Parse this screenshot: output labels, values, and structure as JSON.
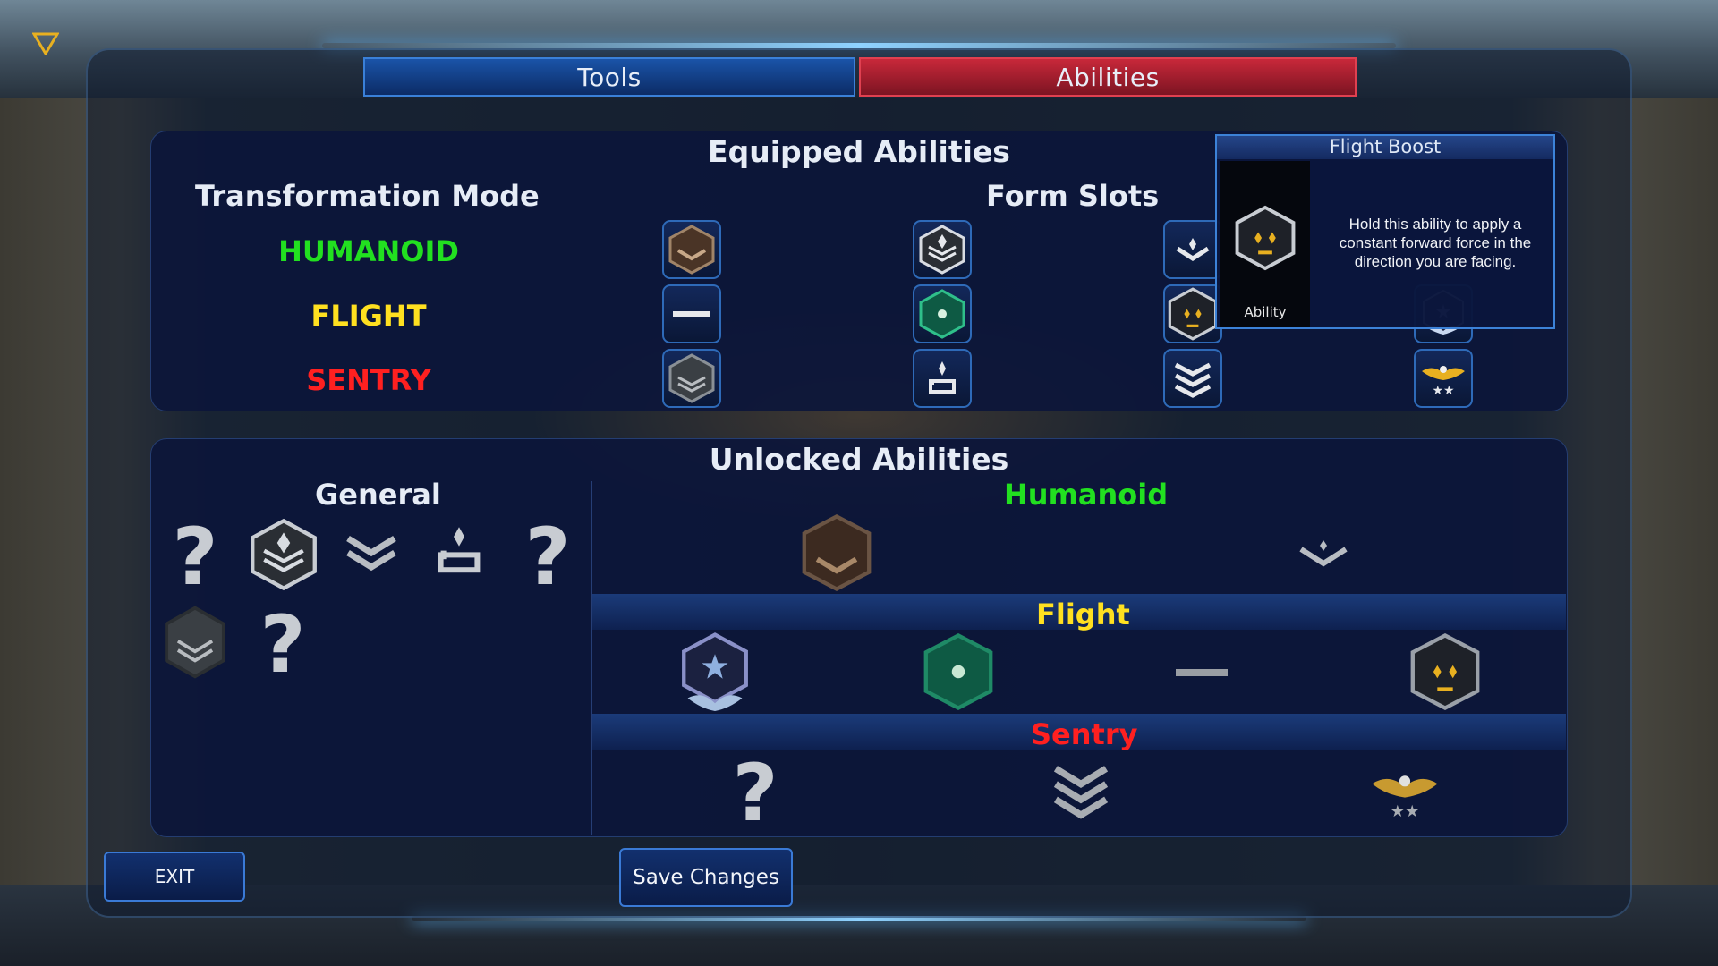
{
  "tabs": [
    {
      "label": "Tools",
      "active": false
    },
    {
      "label": "Abilities",
      "active": true
    }
  ],
  "equipped": {
    "title": "Equipped Abilities",
    "mode_header": "Transformation Mode",
    "slots_header": "Form Slots",
    "modes": [
      {
        "label": "HUMANOID",
        "color": "#22e020",
        "slots": [
          "bronze-chevron-icon",
          "silver-stacked-diamond-icon",
          "silver-chevron-diamond-icon",
          ""
        ]
      },
      {
        "label": "FLIGHT",
        "color": "#ffe020",
        "slots": [
          "silver-bar-icon",
          "green-hexagon-icon",
          "gold-diamonds-hexagon-icon",
          "star-wings-hexagon-icon"
        ]
      },
      {
        "label": "SENTRY",
        "color": "#ff2020",
        "slots": [
          "grey-chevron-hexagon-icon",
          "diamond-pedestal-icon",
          "triple-chevron-icon",
          "eagle-stars-icon"
        ]
      }
    ]
  },
  "tooltip": {
    "title": "Flight Boost",
    "type": "Ability",
    "description": "Hold this ability to apply a constant forward force in the direction you are facing."
  },
  "unlocked": {
    "title": "Unlocked Abilities",
    "general_header": "General",
    "humanoid_header": "Humanoid",
    "flight_header": "Flight",
    "sentry_header": "Sentry",
    "unknown_glyph": "?"
  },
  "buttons": {
    "exit": "EXIT",
    "save": "Save Changes"
  },
  "colors": {
    "humanoid": "#22e020",
    "flight": "#ffe020",
    "sentry": "#ff2020",
    "tab_active": "#c8283a",
    "tab_inactive": "#1a54a8"
  }
}
